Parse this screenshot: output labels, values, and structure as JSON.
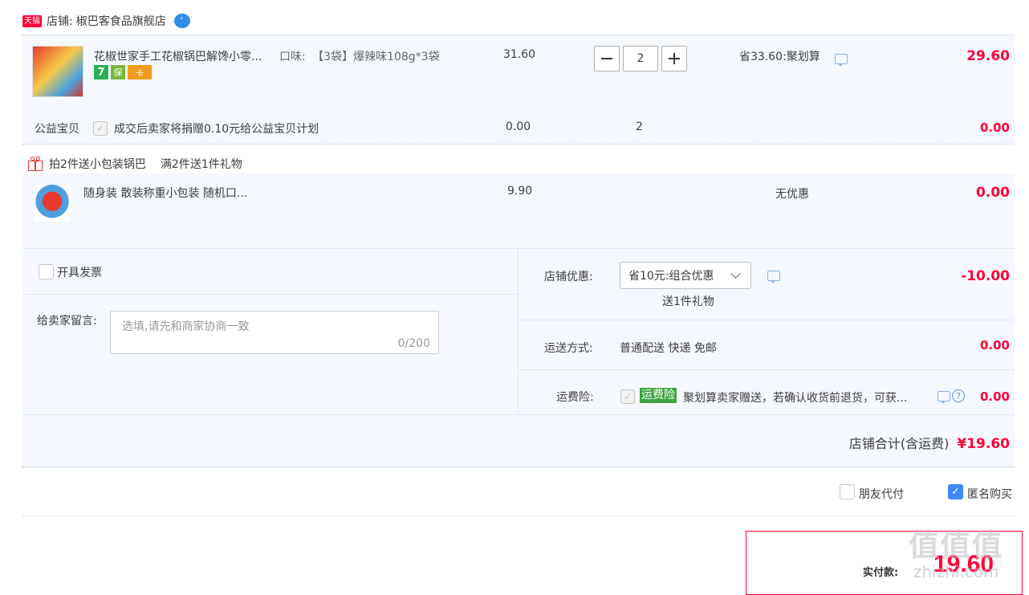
{
  "store": {
    "badge": "天猫",
    "label": "店铺:",
    "name": "椒巴客食品旗舰店",
    "chat_icon": "wangwang-chat-icon"
  },
  "item": {
    "title": "花椒世家手工花椒锅巴解馋小零...",
    "flavor_label": "口味:",
    "flavor_value": "【3袋】爆辣味108g*3袋",
    "unit_price": "31.60",
    "quantity": "2",
    "discount": "省33.60:聚划算",
    "total": "29.60",
    "badges": [
      "7",
      "保",
      "卡"
    ]
  },
  "charity": {
    "label": "公益宝贝",
    "text": "成交后卖家将捐赠0.10元给公益宝贝计划",
    "price": "0.00",
    "quantity": "2",
    "total": "0.00"
  },
  "gift": {
    "title": "拍2件送小包装锅巴",
    "rule": "满2件送1件礼物",
    "item_title": "随身装 散装称重小包装 随机口...",
    "price": "9.90",
    "discount": "无优惠",
    "total": "0.00"
  },
  "invoice": {
    "label": "开具发票"
  },
  "message": {
    "label": "给卖家留言:",
    "placeholder": "选填,请先和商家协商一致",
    "counter": "0/200"
  },
  "store_discount": {
    "label": "店铺优惠:",
    "selected": "省10元:组合优惠",
    "sub": "送1件礼物",
    "amount": "-10.00"
  },
  "shipping": {
    "label": "运送方式:",
    "value": "普通配送 快递 免邮",
    "amount": "0.00"
  },
  "insurance": {
    "label": "运费险:",
    "tag": "运费险",
    "text": "聚划算卖家赠送，若确认收货前退货，可获...",
    "amount": "0.00"
  },
  "summary": {
    "label": "店铺合计(含运费)",
    "amount": "¥19.60"
  },
  "options": {
    "friend_pay": "朋友代付",
    "anonymous": "匿名购买"
  },
  "payment": {
    "label": "实付款:",
    "amount": "19.60"
  },
  "watermark": {
    "text": "值 值 值",
    "site": "zhizhi.com"
  },
  "colors": {
    "accent_red": "#ff0036",
    "panel_bg": "#f5f8ff",
    "tmall_red": "#ff0036",
    "insurance_green": "#3da642",
    "checkbox_blue": "#3f88f5"
  }
}
